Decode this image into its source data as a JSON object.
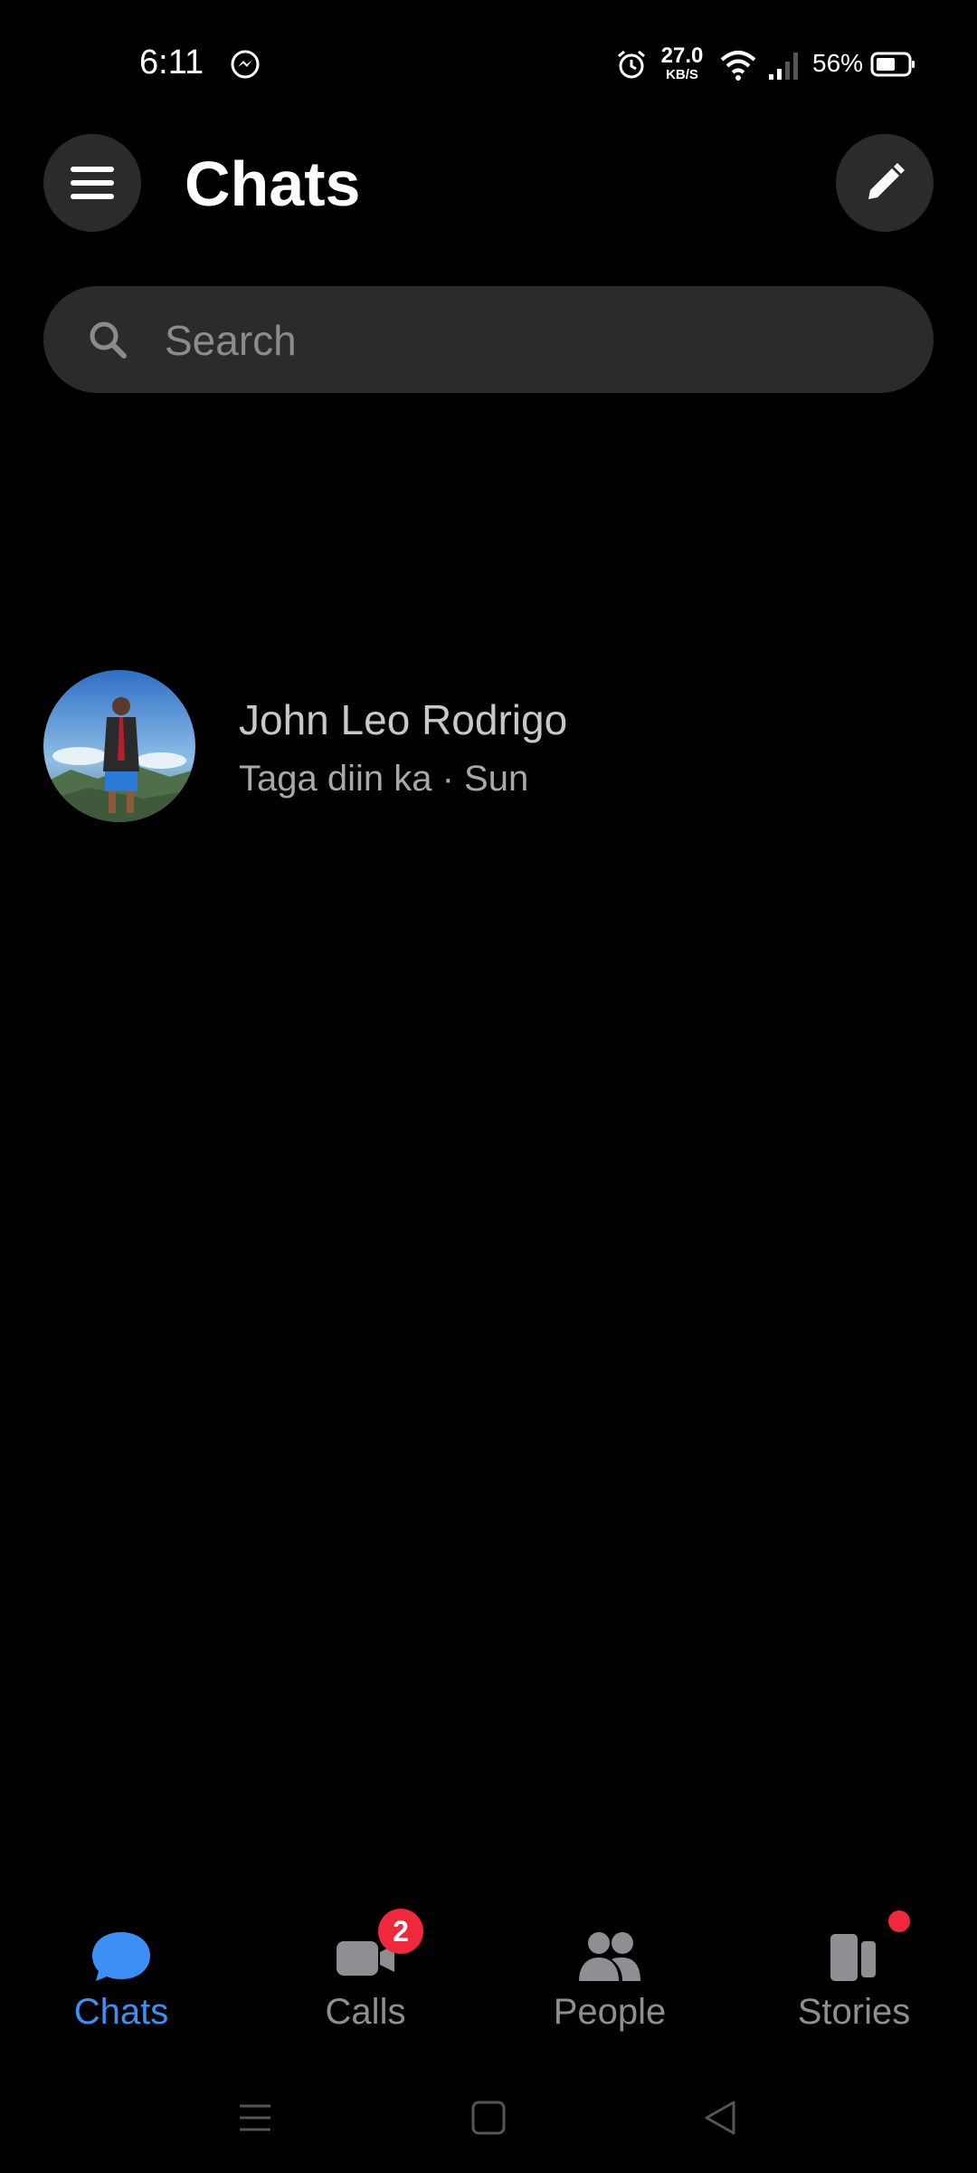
{
  "status_bar": {
    "time": "6:11",
    "net_speed_value": "27.0",
    "net_speed_unit": "KB/S",
    "battery_percent": "56%",
    "icons": [
      "messenger-icon",
      "alarm-icon",
      "wifi-icon",
      "signal-icon",
      "battery-icon"
    ]
  },
  "header": {
    "title": "Chats",
    "menu_icon": "menu-icon",
    "compose_icon": "pencil-icon"
  },
  "search": {
    "placeholder": "Search",
    "icon": "search-icon"
  },
  "chats": [
    {
      "name": "John Leo Rodrigo",
      "preview": "Taga diin ka · Sun",
      "avatar": "profile-photo"
    }
  ],
  "bottom_nav": {
    "items": [
      {
        "label": "Chats",
        "icon": "chat-bubble-icon",
        "active": true
      },
      {
        "label": "Calls",
        "icon": "video-call-icon",
        "badge": "2"
      },
      {
        "label": "People",
        "icon": "people-icon"
      },
      {
        "label": "Stories",
        "icon": "stories-icon",
        "dot": true
      }
    ]
  },
  "colors": {
    "background": "#000000",
    "surface": "#2b2b2b",
    "accent": "#3b8ff5",
    "badge": "#f0283c",
    "inactive": "#8e8e93"
  }
}
